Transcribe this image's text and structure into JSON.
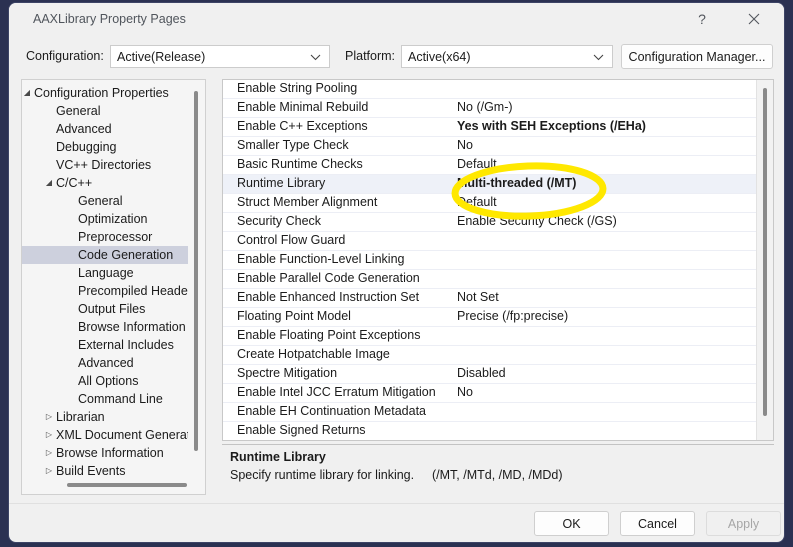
{
  "window": {
    "title": "AAXLibrary Property Pages",
    "help_icon": "help-question-icon",
    "close_icon": "close-icon"
  },
  "configbar": {
    "configuration_label": "Configuration:",
    "configuration_value": "Active(Release)",
    "platform_label": "Platform:",
    "platform_value": "Active(x64)",
    "configuration_manager_label": "Configuration Manager..."
  },
  "tree": {
    "items": [
      {
        "label": "Configuration Properties",
        "indent": 0,
        "arrow": "expanded",
        "selected": false
      },
      {
        "label": "General",
        "indent": 1,
        "arrow": "none",
        "selected": false
      },
      {
        "label": "Advanced",
        "indent": 1,
        "arrow": "none",
        "selected": false
      },
      {
        "label": "Debugging",
        "indent": 1,
        "arrow": "none",
        "selected": false
      },
      {
        "label": "VC++ Directories",
        "indent": 1,
        "arrow": "none",
        "selected": false
      },
      {
        "label": "C/C++",
        "indent": 1,
        "arrow": "expanded",
        "selected": false
      },
      {
        "label": "General",
        "indent": 2,
        "arrow": "none",
        "selected": false
      },
      {
        "label": "Optimization",
        "indent": 2,
        "arrow": "none",
        "selected": false
      },
      {
        "label": "Preprocessor",
        "indent": 2,
        "arrow": "none",
        "selected": false
      },
      {
        "label": "Code Generation",
        "indent": 2,
        "arrow": "none",
        "selected": true
      },
      {
        "label": "Language",
        "indent": 2,
        "arrow": "none",
        "selected": false
      },
      {
        "label": "Precompiled Headers",
        "indent": 2,
        "arrow": "none",
        "selected": false
      },
      {
        "label": "Output Files",
        "indent": 2,
        "arrow": "none",
        "selected": false
      },
      {
        "label": "Browse Information",
        "indent": 2,
        "arrow": "none",
        "selected": false
      },
      {
        "label": "External Includes",
        "indent": 2,
        "arrow": "none",
        "selected": false
      },
      {
        "label": "Advanced",
        "indent": 2,
        "arrow": "none",
        "selected": false
      },
      {
        "label": "All Options",
        "indent": 2,
        "arrow": "none",
        "selected": false
      },
      {
        "label": "Command Line",
        "indent": 2,
        "arrow": "none",
        "selected": false
      },
      {
        "label": "Librarian",
        "indent": 1,
        "arrow": "collapsed",
        "selected": false
      },
      {
        "label": "XML Document Generator",
        "indent": 1,
        "arrow": "collapsed",
        "selected": false
      },
      {
        "label": "Browse Information",
        "indent": 1,
        "arrow": "collapsed",
        "selected": false
      },
      {
        "label": "Build Events",
        "indent": 1,
        "arrow": "collapsed",
        "selected": false
      }
    ]
  },
  "grid": {
    "rows": [
      {
        "name": "Enable String Pooling",
        "value": "",
        "bold": false,
        "selected": false
      },
      {
        "name": "Enable Minimal Rebuild",
        "value": "No (/Gm-)",
        "bold": false,
        "selected": false
      },
      {
        "name": "Enable C++ Exceptions",
        "value": "Yes with SEH Exceptions (/EHa)",
        "bold": true,
        "selected": false
      },
      {
        "name": "Smaller Type Check",
        "value": "No",
        "bold": false,
        "selected": false
      },
      {
        "name": "Basic Runtime Checks",
        "value": "Default",
        "bold": false,
        "selected": false
      },
      {
        "name": "Runtime Library",
        "value": "Multi-threaded (/MT)",
        "bold": true,
        "selected": true
      },
      {
        "name": "Struct Member Alignment",
        "value": "Default",
        "bold": false,
        "selected": false
      },
      {
        "name": "Security Check",
        "value": "Enable Security Check (/GS)",
        "bold": false,
        "selected": false
      },
      {
        "name": "Control Flow Guard",
        "value": "",
        "bold": false,
        "selected": false
      },
      {
        "name": "Enable Function-Level Linking",
        "value": "",
        "bold": false,
        "selected": false
      },
      {
        "name": "Enable Parallel Code Generation",
        "value": "",
        "bold": false,
        "selected": false
      },
      {
        "name": "Enable Enhanced Instruction Set",
        "value": "Not Set",
        "bold": false,
        "selected": false
      },
      {
        "name": "Floating Point Model",
        "value": "Precise (/fp:precise)",
        "bold": false,
        "selected": false
      },
      {
        "name": "Enable Floating Point Exceptions",
        "value": "",
        "bold": false,
        "selected": false
      },
      {
        "name": "Create Hotpatchable Image",
        "value": "",
        "bold": false,
        "selected": false
      },
      {
        "name": "Spectre Mitigation",
        "value": "Disabled",
        "bold": false,
        "selected": false
      },
      {
        "name": "Enable Intel JCC Erratum Mitigation",
        "value": "No",
        "bold": false,
        "selected": false
      },
      {
        "name": "Enable EH Continuation Metadata",
        "value": "",
        "bold": false,
        "selected": false
      },
      {
        "name": "Enable Signed Returns",
        "value": "",
        "bold": false,
        "selected": false
      }
    ]
  },
  "annotation": {
    "shape": "ellipse",
    "color": "#FFE800",
    "targets": "Runtime Library value"
  },
  "description": {
    "title": "Runtime Library",
    "body": "Specify runtime library for linking.",
    "args": "(/MT, /MTd, /MD, /MDd)"
  },
  "footer": {
    "ok_label": "OK",
    "cancel_label": "Cancel",
    "apply_label": "Apply",
    "apply_disabled": true
  }
}
